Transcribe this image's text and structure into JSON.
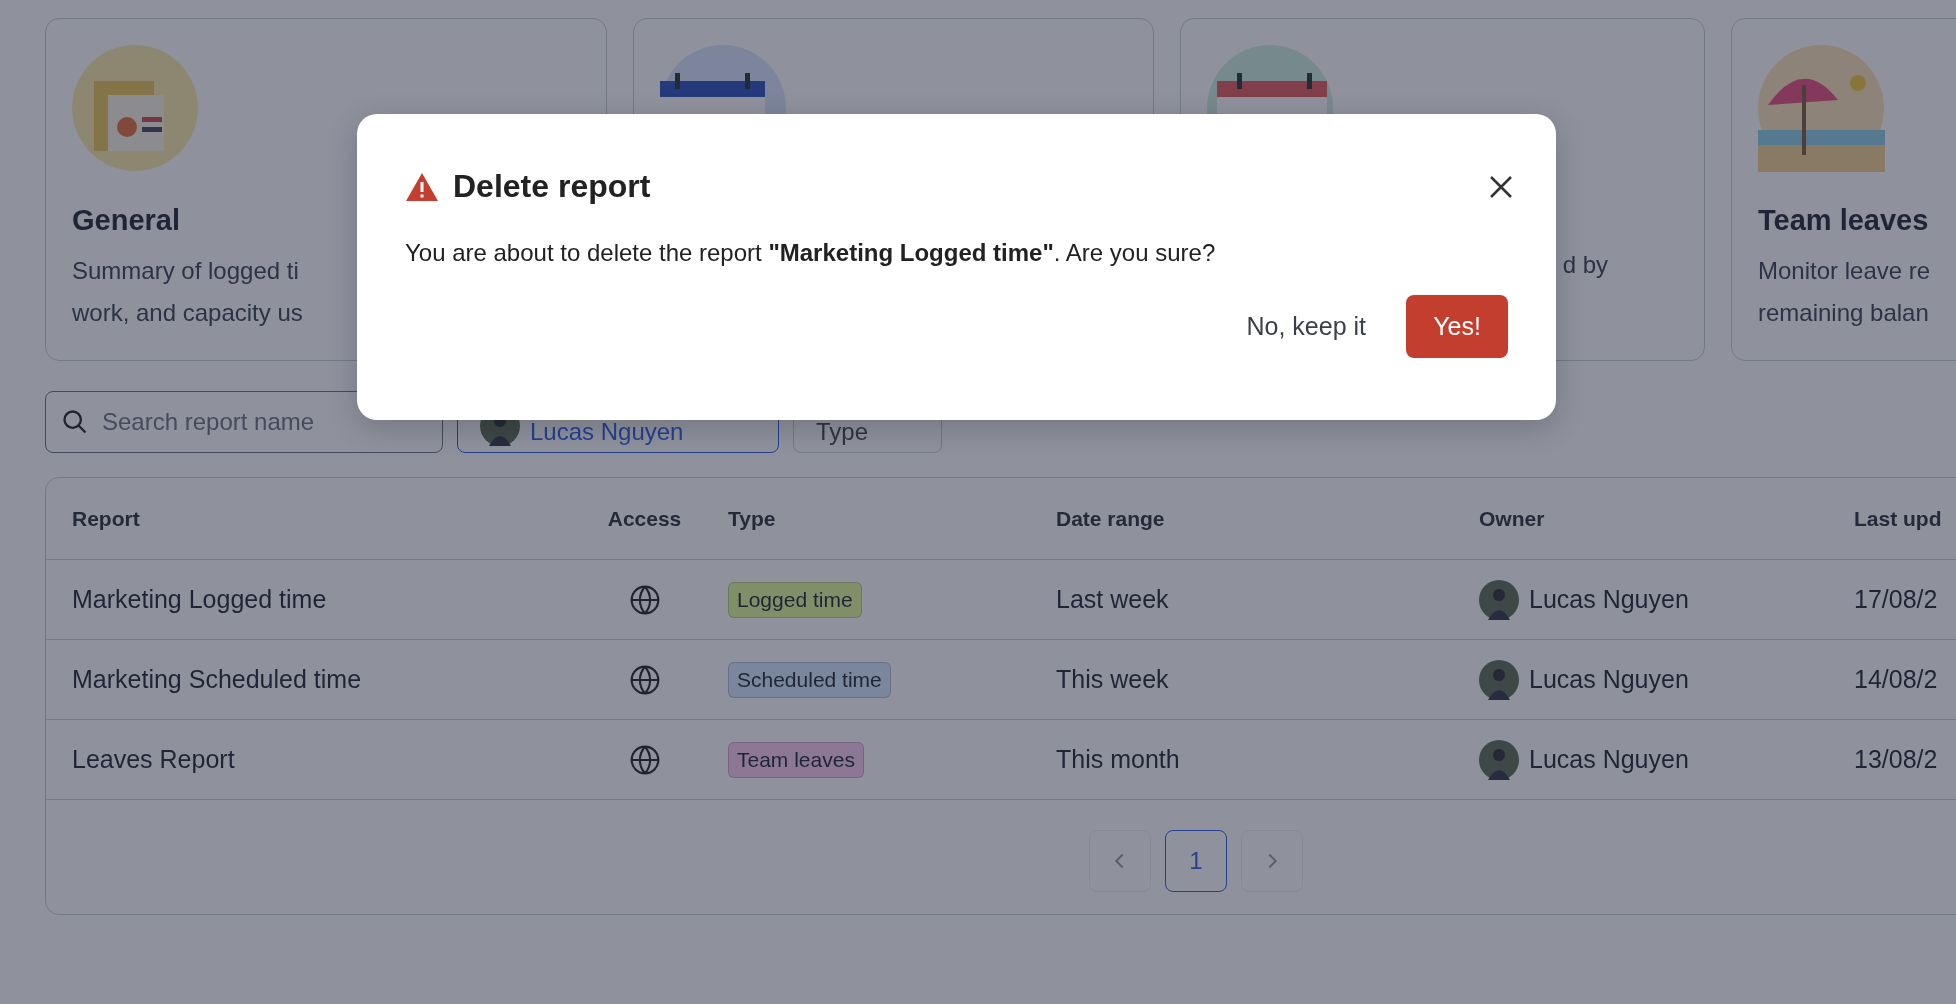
{
  "cards": [
    {
      "kind": "report",
      "title": "General",
      "description_lines": [
        "Summary of logged ti",
        "work, and capacity us"
      ]
    },
    {
      "kind": "calendar"
    },
    {
      "kind": "calendar",
      "description_lines": [
        "d by"
      ]
    },
    {
      "kind": "beach",
      "title": "Team leaves",
      "description_lines": [
        "Monitor leave re",
        "remaining balan"
      ]
    }
  ],
  "filters": {
    "search": {
      "placeholder": "Search report name"
    },
    "chips": [
      {
        "kind": "owner",
        "label": "Lucas Nguyen",
        "active": true
      },
      {
        "kind": "plain",
        "label": "Type",
        "active": false
      }
    ]
  },
  "table": {
    "columns": [
      "Report",
      "Access",
      "Type",
      "Date range",
      "Owner",
      "Last upd"
    ],
    "rows": [
      {
        "report": "Marketing Logged time",
        "type": {
          "label": "Logged time",
          "color": "#7f9068"
        },
        "date_range": "Last week",
        "owner": "Lucas Nguyen",
        "last_updated": "17/08/2"
      },
      {
        "report": "Marketing Scheduled time",
        "type": {
          "label": "Scheduled time",
          "color": "#7a869b"
        },
        "date_range": "This week",
        "owner": "Lucas Nguyen",
        "last_updated": "14/08/2"
      },
      {
        "report": "Leaves Report",
        "type": {
          "label": "Team leaves",
          "color": "#8c7896"
        },
        "date_range": "This month",
        "owner": "Lucas Nguyen",
        "last_updated": "13/08/2"
      }
    ]
  },
  "pagination": {
    "prev": {
      "disabled": true
    },
    "pages": [
      {
        "label": "1",
        "selected": true
      }
    ],
    "next": {
      "disabled": true
    }
  },
  "dialog": {
    "title": "Delete report",
    "message": "You are about to delete the report **\"Marketing Logged time\"**. Are you sure?",
    "cancel": "No, keep it",
    "confirm": "Yes!"
  }
}
